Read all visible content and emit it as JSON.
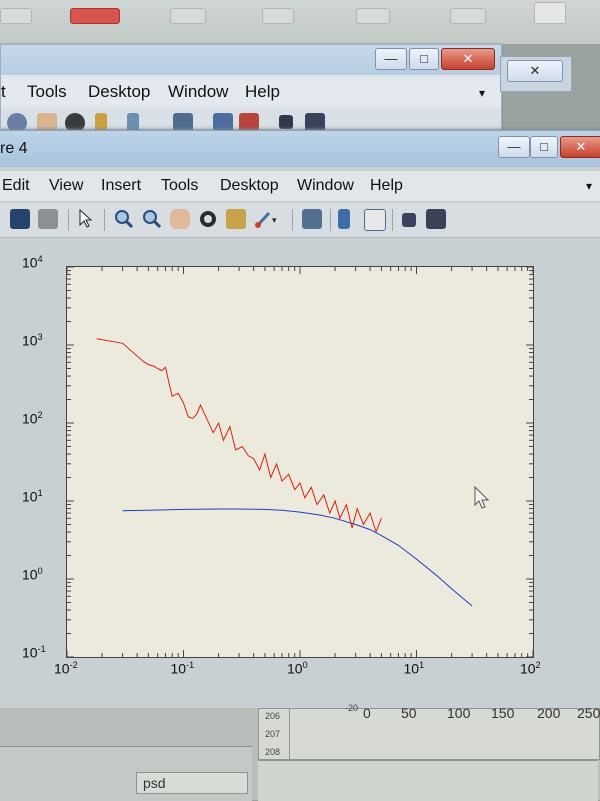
{
  "background_window": {
    "menu": [
      "t",
      "Tools",
      "Desktop",
      "Window",
      "Help"
    ],
    "minimize": "—",
    "maximize": "□",
    "close": "✕",
    "second_window_close": "✕"
  },
  "figure_window": {
    "title": "re 4",
    "minimize": "—",
    "maximize": "□",
    "close": "✕",
    "menu": [
      "Edit",
      "View",
      "Insert",
      "Tools",
      "Desktop",
      "Window",
      "Help"
    ],
    "toolbar_icons": [
      "save-icon",
      "print-icon",
      "pointer-icon",
      "zoom-in-icon",
      "zoom-out-icon",
      "pan-hand-icon",
      "rotate-3d-icon",
      "data-cursor-icon",
      "brush-icon",
      "link-plot-icon",
      "colorbar-icon",
      "legend-icon",
      "hide-plot-tools-icon",
      "show-plot-tools-icon"
    ]
  },
  "chart_data": {
    "type": "line",
    "xscale": "log",
    "yscale": "log",
    "xlim": [
      0.01,
      100
    ],
    "ylim": [
      0.1,
      10000
    ],
    "x_ticks": [
      {
        "base": "10",
        "exp": "-2"
      },
      {
        "base": "10",
        "exp": "-1"
      },
      {
        "base": "10",
        "exp": "0"
      },
      {
        "base": "10",
        "exp": "1"
      },
      {
        "base": "10",
        "exp": "2"
      }
    ],
    "y_ticks": [
      {
        "base": "10",
        "exp": "-1"
      },
      {
        "base": "10",
        "exp": "0"
      },
      {
        "base": "10",
        "exp": "1"
      },
      {
        "base": "10",
        "exp": "2"
      },
      {
        "base": "10",
        "exp": "3"
      },
      {
        "base": "10",
        "exp": "4"
      }
    ],
    "series": [
      {
        "color": "#e02010",
        "x": [
          0.018,
          0.03,
          0.045,
          0.05,
          0.055,
          0.06,
          0.065,
          0.07,
          0.075,
          0.08,
          0.09,
          0.1,
          0.11,
          0.12,
          0.13,
          0.14,
          0.16,
          0.18,
          0.2,
          0.22,
          0.25,
          0.28,
          0.32,
          0.36,
          0.4,
          0.45,
          0.5,
          0.56,
          0.63,
          0.7,
          0.8,
          0.9,
          1.0,
          1.1,
          1.25,
          1.4,
          1.6,
          1.8,
          2.0,
          2.2,
          2.5,
          2.8,
          3.1,
          3.5,
          4.0,
          4.5,
          5.0
        ],
        "y": [
          1200,
          1050,
          620,
          560,
          540,
          500,
          470,
          520,
          330,
          220,
          240,
          180,
          120,
          115,
          130,
          170,
          110,
          75,
          100,
          60,
          90,
          45,
          50,
          38,
          35,
          25,
          40,
          20,
          30,
          18,
          22,
          14,
          17,
          11,
          15,
          9,
          12,
          7,
          10,
          6,
          9,
          4.5,
          8,
          5,
          7,
          4,
          6
        ]
      },
      {
        "color": "#1f3fc8",
        "x": [
          0.03,
          0.05,
          0.1,
          0.2,
          0.3,
          0.5,
          0.7,
          1.0,
          1.5,
          2.0,
          3.0,
          4.0,
          5.0,
          7.0,
          10.0,
          15.0,
          20.0,
          30.0
        ],
        "y": [
          7.5,
          7.6,
          7.8,
          7.9,
          7.9,
          7.8,
          7.6,
          7.2,
          6.6,
          6.0,
          5.0,
          4.3,
          3.6,
          2.7,
          1.8,
          1.1,
          0.75,
          0.45
        ]
      }
    ]
  },
  "lower_panel": {
    "row_labels": [
      "206",
      "207",
      "208"
    ],
    "axis_ticks": [
      "0",
      "50",
      "100",
      "150",
      "200",
      "250"
    ],
    "tick_partial": "-20",
    "tab_label": "psd"
  }
}
